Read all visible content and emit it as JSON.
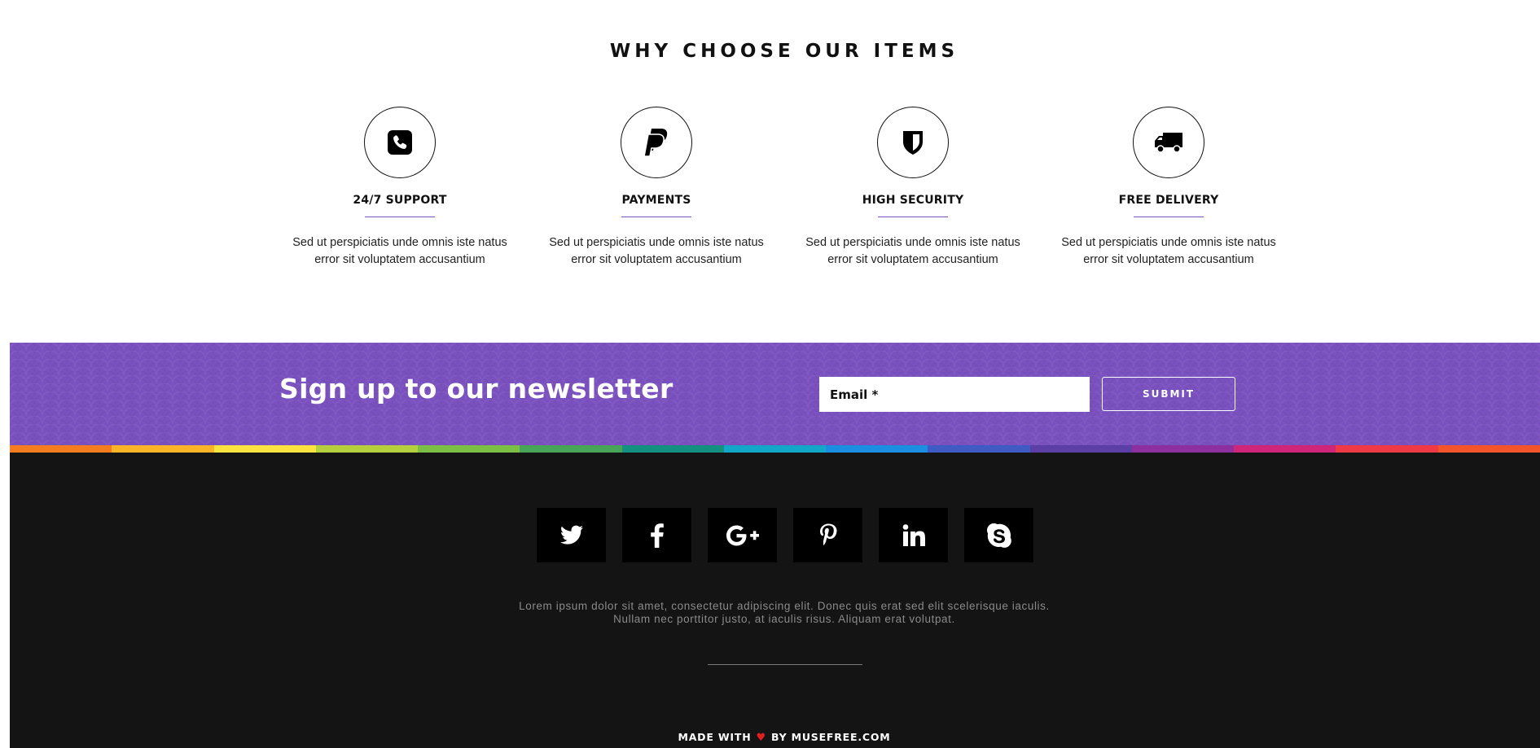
{
  "why_section": {
    "title": "WHY CHOOSE OUR ITEMS",
    "features": [
      {
        "icon": "phone-icon",
        "label": "24/7 SUPPORT",
        "desc_line1": "Sed ut perspiciatis unde omnis iste natus",
        "desc_line2": "error sit voluptatem accusantium"
      },
      {
        "icon": "paypal-icon",
        "label": "PAYMENTS",
        "desc_line1": "Sed ut perspiciatis unde omnis iste natus",
        "desc_line2": "error sit voluptatem accusantium"
      },
      {
        "icon": "shield-icon",
        "label": "HIGH SECURITY",
        "desc_line1": "Sed ut perspiciatis unde omnis iste natus",
        "desc_line2": "error sit voluptatem accusantium"
      },
      {
        "icon": "truck-icon",
        "label": "FREE DELIVERY",
        "desc_line1": "Sed ut perspiciatis unde omnis iste natus",
        "desc_line2": "error sit voluptatem accusantium"
      }
    ],
    "underline_color": "#7a52c0"
  },
  "newsletter": {
    "title": "Sign up to our newsletter",
    "email_value": "",
    "email_placeholder": "Email *",
    "submit_label": "SUBMIT",
    "background_color": "#7a51bf"
  },
  "rainbow_colors": [
    "#f57c1f",
    "#fbb428",
    "#fde340",
    "#b6cf3c",
    "#7bbf45",
    "#48a457",
    "#13907f",
    "#12a6c9",
    "#1a8fe2",
    "#3f5bc4",
    "#5b3fa6",
    "#8e2f9f",
    "#d0267a",
    "#ef3a45",
    "#f3542a"
  ],
  "footer": {
    "social": [
      "twitter-icon",
      "facebook-icon",
      "google-plus-icon",
      "pinterest-icon",
      "linkedin-icon",
      "skype-icon"
    ],
    "text_line1": "Lorem ipsum dolor sit amet, consectetur adipiscing elit. Donec quis erat sed elit scelerisque iaculis.",
    "text_line2": "Nullam nec porttitor justo, at iaculis risus. Aliquam erat volutpat.",
    "credit_prefix": "MADE WITH",
    "credit_heart": "♥",
    "credit_suffix": "BY MUSEFREE.COM",
    "background_color": "#141414"
  }
}
